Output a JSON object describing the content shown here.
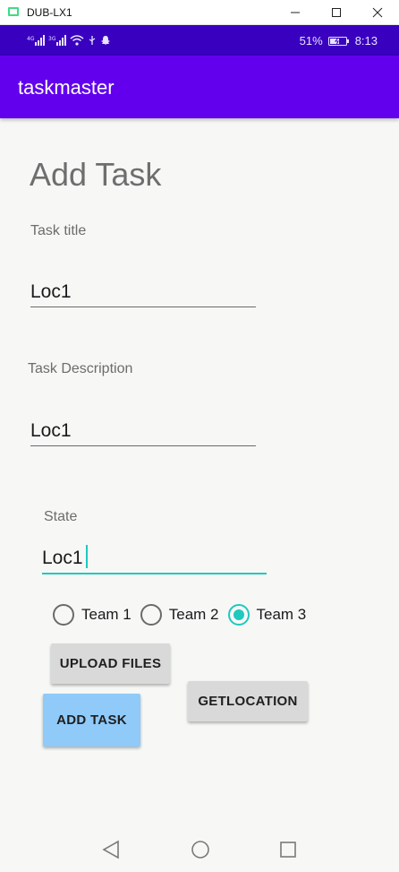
{
  "window": {
    "title": "DUB-LX1",
    "icons": {
      "app": "android-device-icon",
      "minimize": "minimize-icon",
      "maximize": "maximize-icon",
      "close": "close-icon"
    }
  },
  "status_bar": {
    "battery_percent": "51%",
    "time": "8:13",
    "left_icons": [
      "signal-4g-icon",
      "signal-3g-icon",
      "wifi-icon",
      "usb-icon",
      "snapchat-icon"
    ],
    "background": "#3a00bf"
  },
  "app_bar": {
    "title": "taskmaster",
    "background": "#6200ee"
  },
  "form": {
    "heading": "Add Task",
    "title_label": "Task title",
    "title_value": "Loc1",
    "description_label": "Task Description",
    "description_value": "Loc1",
    "state_label": "State",
    "state_value": "Loc1",
    "accent_color": "#1ec9c0"
  },
  "teams": {
    "options": [
      "Team 1",
      "Team 2",
      "Team 3"
    ],
    "selected": "Team 3"
  },
  "buttons": {
    "upload": "UPLOAD FILES",
    "get_location": "GETLOCATION",
    "add_task": "ADD TASK"
  },
  "nav": {
    "back": "back-triangle-icon",
    "home": "home-circle-icon",
    "recents": "recents-square-icon"
  }
}
